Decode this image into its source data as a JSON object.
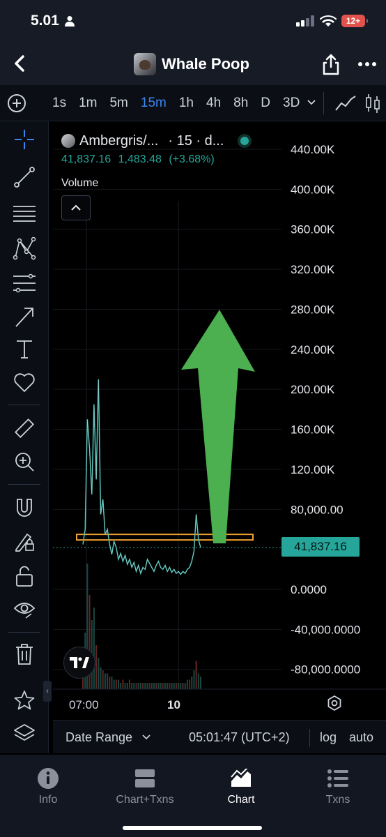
{
  "status_bar": {
    "time": "5.01",
    "battery": "12+"
  },
  "header": {
    "title": "Whale Poop",
    "icons": [
      "back-chevron-icon",
      "share-icon",
      "more-dots-icon"
    ]
  },
  "intervals": {
    "items": [
      "1s",
      "1m",
      "5m",
      "15m",
      "1h",
      "4h",
      "8h",
      "D",
      "3D"
    ],
    "active": "15m"
  },
  "tools": [
    "crosshair-icon",
    "trend-line-icon",
    "horizontal-lines-icon",
    "pattern-icon",
    "fib-retracement-icon",
    "arrow-brush-icon",
    "text-icon",
    "heart-icon",
    "ruler-icon",
    "zoom-in-icon",
    "magnet-icon",
    "lock-drawing-icon",
    "unlock-icon",
    "eye-icon",
    "trash-icon",
    "star-icon",
    "layers-icon"
  ],
  "legend": {
    "symbol": "Ambergris/...",
    "interval_suffix": "· 15 · d...",
    "price": "41,837.16",
    "change": "1,483.48",
    "change_pct": "(+3.68%)",
    "volume_label": "Volume"
  },
  "chart_data": {
    "type": "line",
    "title": "",
    "xlabel": "",
    "ylabel": "",
    "ylim": [
      -100000,
      460000
    ],
    "y_ticks": [
      "440.00K",
      "400.00K",
      "360.00K",
      "320.00K",
      "280.00K",
      "240.00K",
      "200.00K",
      "160.00K",
      "120.00K",
      "80,000.00",
      "41,837.16",
      "0.0000",
      "-40,000.0000",
      "-80,000.0000"
    ],
    "y_tick_values": [
      440000,
      400000,
      360000,
      320000,
      280000,
      240000,
      200000,
      160000,
      120000,
      80000,
      0,
      -40000,
      -80000
    ],
    "x_ticks": [
      "07:00",
      "10"
    ],
    "last_price": 41837.16,
    "last_price_label": "41,837.16",
    "series": [
      {
        "values": [
          45000,
          60000,
          170000,
          140000,
          95000,
          185000,
          110000,
          210000,
          75000,
          90000,
          55000,
          60000,
          45000,
          35000,
          48000,
          42000,
          30000,
          36000,
          28000,
          34000,
          25000,
          30000,
          22000,
          27000,
          18000,
          24000,
          16000,
          22000,
          20000,
          30000,
          26000,
          22000,
          18000,
          24000,
          28000,
          22000,
          20000,
          24000,
          18000,
          22000,
          17000,
          20000,
          16000,
          18000,
          15000,
          18000,
          16000,
          20000,
          22000,
          28000,
          38000,
          75000,
          50000,
          41837
        ]
      }
    ],
    "volume": [
      6,
      18,
      40,
      30,
      22,
      26,
      14,
      10,
      7,
      6,
      5,
      5,
      4,
      4,
      3,
      3,
      3,
      2,
      3,
      2,
      2,
      3,
      2,
      2,
      2,
      2,
      2,
      2,
      2,
      2,
      2,
      2,
      2,
      2,
      2,
      2,
      2,
      2,
      2,
      2,
      2,
      2,
      2,
      2,
      2,
      2,
      2,
      3,
      3,
      4,
      6,
      9,
      5,
      4
    ],
    "annotations": [
      "orange-support-rectangle",
      "green-up-arrow"
    ]
  },
  "bottom_bar": {
    "date_range": "Date Range",
    "clock": "05:01:47 (UTC+2)",
    "log": "log",
    "auto": "auto"
  },
  "tabs": [
    {
      "label": "Info",
      "icon": "info-icon",
      "active": false
    },
    {
      "label": "Chart+Txns",
      "icon": "chart-txns-icon",
      "active": false
    },
    {
      "label": "Chart",
      "icon": "chart-icon",
      "active": true
    },
    {
      "label": "Txns",
      "icon": "list-icon",
      "active": false
    }
  ],
  "colors": {
    "accent": "#3a86f0",
    "up": "#26a69a",
    "arrow": "#4caf50",
    "support": "#f0a030"
  }
}
